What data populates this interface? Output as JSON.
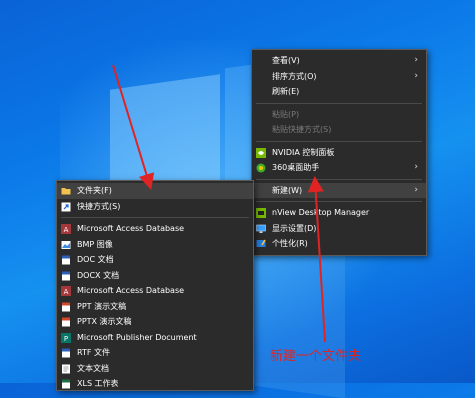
{
  "context_menu": {
    "items": [
      {
        "label": "查看(V)",
        "submenu": true
      },
      {
        "label": "排序方式(O)",
        "submenu": true
      },
      {
        "label": "刷新(E)"
      },
      {
        "label": "粘贴(P)",
        "disabled": true
      },
      {
        "label": "粘贴快捷方式(S)",
        "disabled": true
      },
      {
        "label": "NVIDIA 控制面板",
        "icon": "nvidia-icon"
      },
      {
        "label": "360桌面助手",
        "icon": "360-icon",
        "submenu": true
      },
      {
        "label": "新建(W)",
        "submenu": true,
        "highlighted": true
      },
      {
        "label": "nView Desktop Manager",
        "icon": "nview-icon"
      },
      {
        "label": "显示设置(D)",
        "icon": "display-icon"
      },
      {
        "label": "个性化(R)",
        "icon": "personalize-icon"
      }
    ]
  },
  "new_submenu": {
    "items": [
      {
        "label": "文件夹(F)",
        "icon": "folder-icon",
        "highlighted": true
      },
      {
        "label": "快捷方式(S)",
        "icon": "shortcut-icon"
      },
      {
        "label": "Microsoft Access Database",
        "icon": "access-icon"
      },
      {
        "label": "BMP 图像",
        "icon": "bmp-icon"
      },
      {
        "label": "DOC 文档",
        "icon": "doc-icon"
      },
      {
        "label": "DOCX 文档",
        "icon": "docx-icon"
      },
      {
        "label": "Microsoft Access Database",
        "icon": "access-icon"
      },
      {
        "label": "PPT 演示文稿",
        "icon": "ppt-icon"
      },
      {
        "label": "PPTX 演示文稿",
        "icon": "pptx-icon"
      },
      {
        "label": "Microsoft Publisher Document",
        "icon": "publisher-icon"
      },
      {
        "label": "RTF 文件",
        "icon": "rtf-icon"
      },
      {
        "label": "文本文档",
        "icon": "txt-icon"
      },
      {
        "label": "XLS 工作表",
        "icon": "xls-icon"
      }
    ]
  },
  "annotation": {
    "caption": "新建一个文件夹",
    "color": "#e02424"
  }
}
